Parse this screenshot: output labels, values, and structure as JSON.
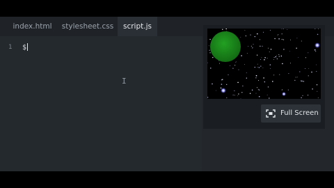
{
  "tabs": [
    {
      "label": "index.html",
      "active": false
    },
    {
      "label": "stylesheet.css",
      "active": false
    },
    {
      "label": "script.js",
      "active": true
    }
  ],
  "editor": {
    "lines": [
      {
        "number": "1",
        "text": "$"
      }
    ]
  },
  "preview": {
    "fullscreen_label": "Full Screen",
    "fullscreen_icon": "fullscreen-icon",
    "planet_color": "#1f8a1f"
  },
  "colors": {
    "background": "#23272c",
    "tab_active": "#2a2f35",
    "panel": "#1a1d21"
  }
}
